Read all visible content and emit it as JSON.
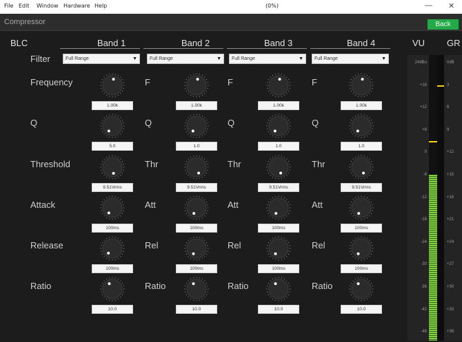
{
  "menu": [
    "File",
    "Edit",
    "Window",
    "Hardware",
    "Help"
  ],
  "window_title": "(0%)",
  "window_controls": {
    "minimize": "—",
    "close": "✕"
  },
  "app_title": "Compressor",
  "back_label": "Back",
  "blc_label": "BLC",
  "bands": [
    "Band 1",
    "Band 2",
    "Band 3",
    "Band 4"
  ],
  "vu_label": "VU",
  "gr_label": "GR",
  "filter_label": "Filter",
  "filter_values": [
    "Full Range",
    "Full Range",
    "Full Range",
    "Full Range"
  ],
  "rows": [
    {
      "label": "Frequency",
      "short": "F",
      "values": [
        "1.00k",
        "1.00k",
        "1.00k",
        "1.00k"
      ]
    },
    {
      "label": "Q",
      "short": "Q",
      "values": [
        "5.0",
        "1.0",
        "1.0",
        "1.0"
      ]
    },
    {
      "label": "Threshold",
      "short": "Thr",
      "values": [
        "9.51Vrms",
        "9.51Vrms",
        "9.51Vrms",
        "9.51Vrms"
      ]
    },
    {
      "label": "Attack",
      "short": "Att",
      "values": [
        "100ms",
        "100ms",
        "100ms",
        "100ms"
      ]
    },
    {
      "label": "Release",
      "short": "Rel",
      "values": [
        "100ms",
        "100ms",
        "100ms",
        "100ms"
      ]
    },
    {
      "label": "Ratio",
      "short": "Ratio",
      "values": [
        "10.0",
        "10.0",
        "10.0",
        "10.0"
      ]
    }
  ],
  "knob_angles": [
    [
      10,
      10,
      10,
      10
    ],
    [
      215,
      215,
      215,
      215
    ],
    [
      170,
      160,
      160,
      160
    ],
    [
      215,
      205,
      205,
      205
    ],
    [
      220,
      210,
      210,
      210
    ],
    [
      330,
      330,
      330,
      330
    ]
  ],
  "vu_scale": [
    "24dBu",
    "+18",
    "+12",
    "+6",
    "0",
    "-6",
    "-12",
    "-18",
    "-24",
    "-30",
    "-36",
    "-42",
    "-48"
  ],
  "gr_scale": [
    "0dB",
    "3",
    "6",
    "9",
    "+12",
    "+15",
    "+18",
    "+21",
    "+24",
    "+27",
    "+30",
    "+33",
    "+36"
  ],
  "vu_level_fraction": 0.58,
  "vu_peak_fraction": 0.7,
  "gr_marker_fraction": 0.895,
  "colors": {
    "meter_green": "#7fcf3f",
    "marker_yellow": "#ffd21a",
    "back_button": "#23a84a"
  }
}
